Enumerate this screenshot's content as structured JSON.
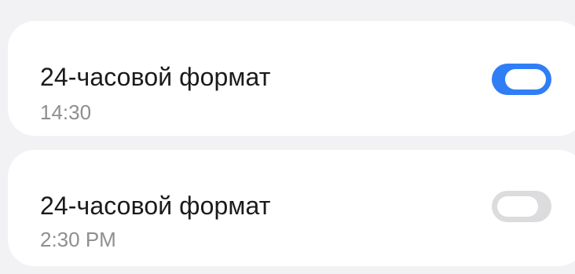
{
  "settings": [
    {
      "title": "24-часовой формат",
      "subtitle": "14:30",
      "toggle_on": true
    },
    {
      "title": "24-часовой формат",
      "subtitle": "2:30 PM",
      "toggle_on": false
    }
  ],
  "colors": {
    "background": "#f2f2f5",
    "card": "#ffffff",
    "toggle_on": "#2f7ef6",
    "toggle_off": "#dcdcde",
    "title_text": "#1b1b1f",
    "subtitle_text": "#8e8e93"
  },
  "icons": [
    "toggle-switch"
  ]
}
